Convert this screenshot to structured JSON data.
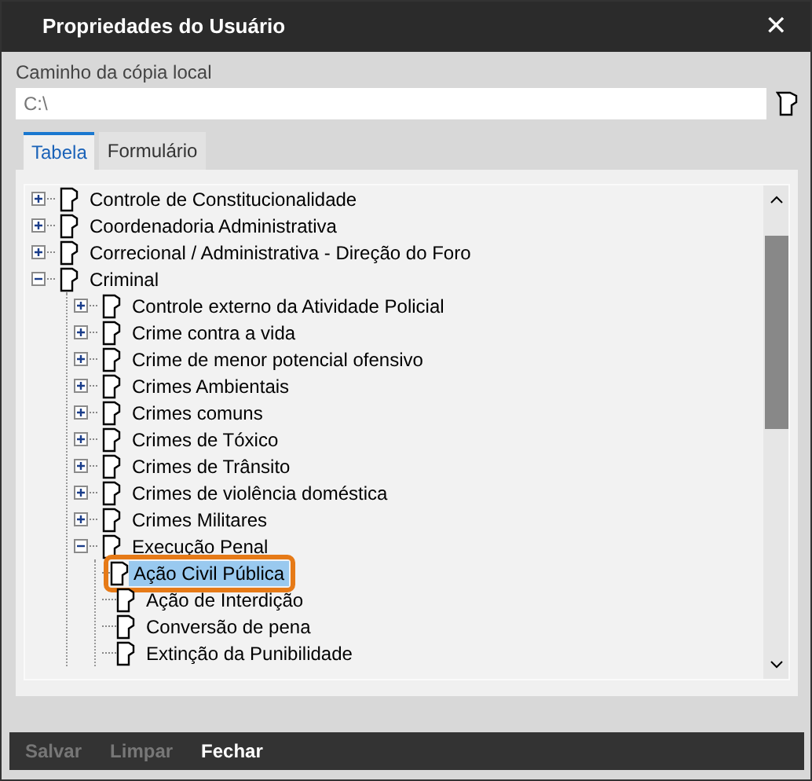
{
  "window": {
    "title": "Propriedades do Usuário",
    "close": "✕"
  },
  "path_field": {
    "label": "Caminho da cópia local",
    "value": "C:\\"
  },
  "tabs": [
    {
      "label": "Tabela",
      "selected": true
    },
    {
      "label": "Formulário",
      "selected": false
    }
  ],
  "tree": [
    {
      "label": "Controle de Constitucionalidade",
      "expanded": false,
      "selected": false
    },
    {
      "label": "Coordenadoria Administrativa",
      "expanded": false,
      "selected": false
    },
    {
      "label": "Correcional / Administrativa - Direção do Foro",
      "expanded": false,
      "selected": false
    },
    {
      "label": "Criminal",
      "expanded": true,
      "selected": false,
      "children": [
        {
          "label": "Controle externo da Atividade Policial",
          "expanded": false,
          "selected": false
        },
        {
          "label": "Crime contra a vida",
          "expanded": false,
          "selected": false
        },
        {
          "label": "Crime de menor potencial ofensivo",
          "expanded": false,
          "selected": false
        },
        {
          "label": "Crimes Ambientais",
          "expanded": false,
          "selected": false
        },
        {
          "label": "Crimes comuns",
          "expanded": false,
          "selected": false
        },
        {
          "label": "Crimes de Tóxico",
          "expanded": false,
          "selected": false
        },
        {
          "label": "Crimes de Trânsito",
          "expanded": false,
          "selected": false
        },
        {
          "label": "Crimes de violência doméstica",
          "expanded": false,
          "selected": false
        },
        {
          "label": "Crimes Militares",
          "expanded": false,
          "selected": false
        },
        {
          "label": "Execução Penal",
          "expanded": true,
          "selected": false,
          "children": [
            {
              "label": "Ação Civil Pública",
              "selected": true
            },
            {
              "label": "Ação de Interdição",
              "selected": false
            },
            {
              "label": "Conversão de pena",
              "selected": false
            },
            {
              "label": "Extinção da Punibilidade",
              "selected": false
            }
          ]
        }
      ]
    }
  ],
  "buttons": [
    {
      "label": "Salvar",
      "disabled": true
    },
    {
      "label": "Limpar",
      "disabled": true
    },
    {
      "label": "Fechar",
      "disabled": false
    }
  ]
}
